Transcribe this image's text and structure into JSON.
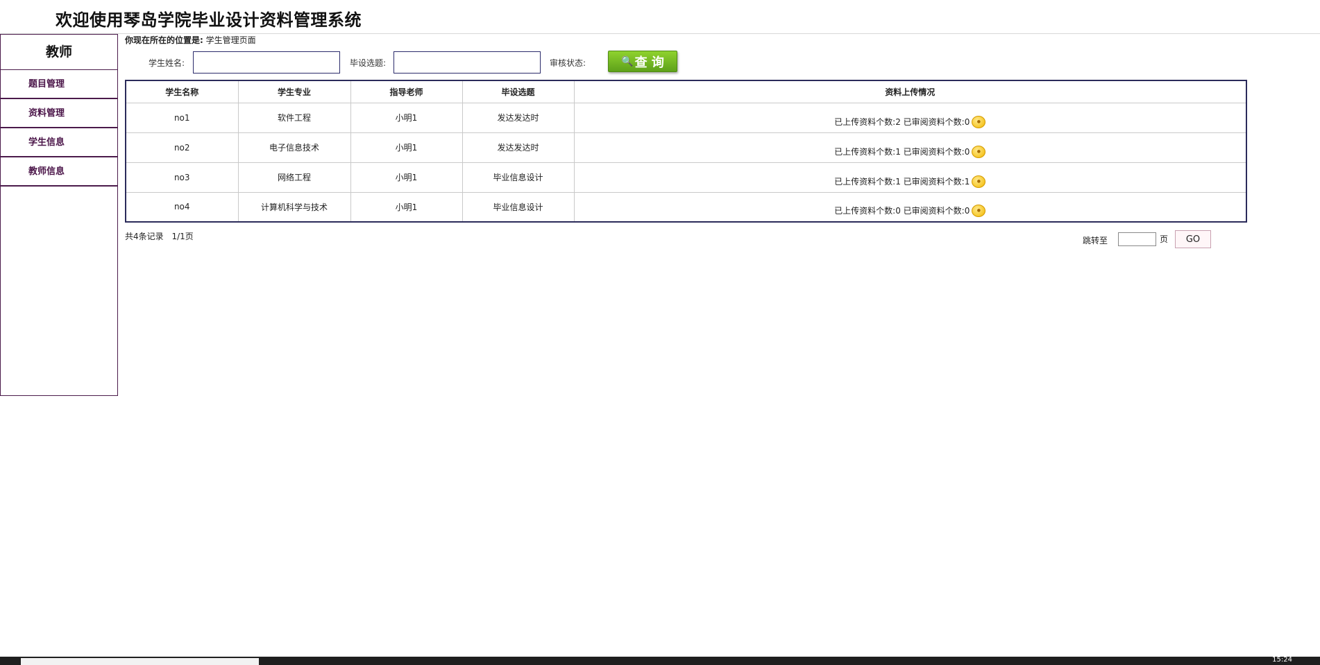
{
  "header": {
    "title": "欢迎使用琴岛学院毕业设计资料管理系统"
  },
  "sidebar": {
    "heading": "教师",
    "items": [
      {
        "label": "题目管理"
      },
      {
        "label": "资料管理"
      },
      {
        "label": "学生信息"
      },
      {
        "label": "教师信息"
      }
    ]
  },
  "location": {
    "label": "你现在所在的位置是:",
    "value": " 学生管理页面"
  },
  "search": {
    "student_name_label": "学生姓名:",
    "student_name_value": "",
    "topic_label": "毕设选题:",
    "topic_value": "",
    "status_label": "审核状态:",
    "query_button": "查 询",
    "query_icon": "magnifier-icon"
  },
  "table": {
    "headers": [
      "学生名称",
      "学生专业",
      "指导老师",
      "毕设选题",
      "资料上传情况"
    ],
    "rows": [
      {
        "name": "no1",
        "major": "软件工程",
        "teacher": "小明1",
        "topic": "发达发达时",
        "upload": "已上传资料个数:2 已审阅资料个数:0"
      },
      {
        "name": "no2",
        "major": "电子信息技术",
        "teacher": "小明1",
        "topic": "发达发达时",
        "upload": "已上传资料个数:1 已审阅资料个数:0"
      },
      {
        "name": "no3",
        "major": "网络工程",
        "teacher": "小明1",
        "topic": "毕业信息设计",
        "upload": "已上传资料个数:1 已审阅资料个数:1"
      },
      {
        "name": "no4",
        "major": "计算机科学与技术",
        "teacher": "小明1",
        "topic": "毕业信息设计",
        "upload": "已上传资料个数:0 已审阅资料个数:0"
      }
    ],
    "row_icon": "coin-icon"
  },
  "pager": {
    "total": "共4条记录",
    "page": "1/1页",
    "jump_label": "跳转至",
    "page_unit": "页",
    "go_button": "GO",
    "jump_value": ""
  },
  "taskbar": {
    "clock": "15:24"
  },
  "colors": {
    "sidebar_border": "#4a1a4a",
    "query_button": "#6fb520",
    "table_border": "#2a2a5a"
  }
}
